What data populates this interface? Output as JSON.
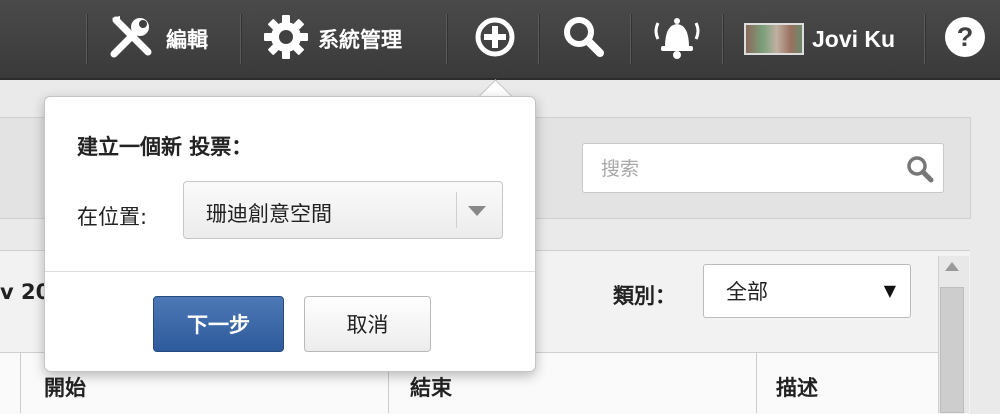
{
  "topbar": {
    "edit_label": "編輯",
    "admin_label": "系統管理",
    "user_name": "Jovi Ku",
    "icons": [
      "tools-icon",
      "gear-icon",
      "add-circle-icon",
      "search-icon",
      "bell-icon",
      "help-icon"
    ]
  },
  "popover": {
    "title": "建立一個新 投票：",
    "location_label": "在位置:",
    "location_value": "珊迪創意空間",
    "next_label": "下一步",
    "cancel_label": "取消"
  },
  "search": {
    "placeholder": "搜索"
  },
  "list": {
    "partial_title": "v 20",
    "category_label": "類別：",
    "category_value": "全部",
    "columns": [
      "開始",
      "結束",
      "描述"
    ]
  },
  "colors": {
    "topbar": "#3f3f3f",
    "primary_button": "#2e5b9c",
    "popover_bg": "#ffffff"
  }
}
